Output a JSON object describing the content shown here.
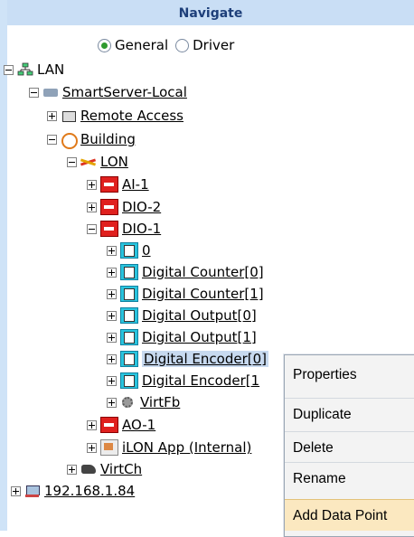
{
  "panel": {
    "title": "Navigate"
  },
  "view_mode": {
    "options": [
      {
        "label": "General",
        "selected": true
      },
      {
        "label": "Driver",
        "selected": false
      }
    ]
  },
  "tree": {
    "lan": "LAN",
    "server": "SmartServer-Local",
    "remote_access": "Remote Access",
    "building": "Building",
    "lon": "LON",
    "ai1": "AI-1",
    "dio2": "DIO-2",
    "dio1": "DIO-1",
    "fb_0": "0",
    "fb_dc0": "Digital Counter[0]",
    "fb_dc1": "Digital Counter[1]",
    "fb_do0": "Digital Output[0]",
    "fb_do1": "Digital Output[1]",
    "fb_de0": "Digital Encoder[0]",
    "fb_de1": "Digital Encoder[1",
    "virtfb": "VirtFb",
    "ao1": "AO-1",
    "ilon_app": "iLON App (Internal)",
    "virtch": "VirtCh",
    "ip": "192.168.1.84"
  },
  "context_menu": {
    "items": [
      "Properties",
      "Duplicate",
      "Delete",
      "Rename",
      "Add Data Point"
    ],
    "highlighted": "Add Data Point"
  },
  "colors": {
    "header_bg": "#c9def5",
    "header_text": "#1e3f7a",
    "selection_bg": "#c7d9ef",
    "menu_highlight": "#fbe8c0"
  }
}
